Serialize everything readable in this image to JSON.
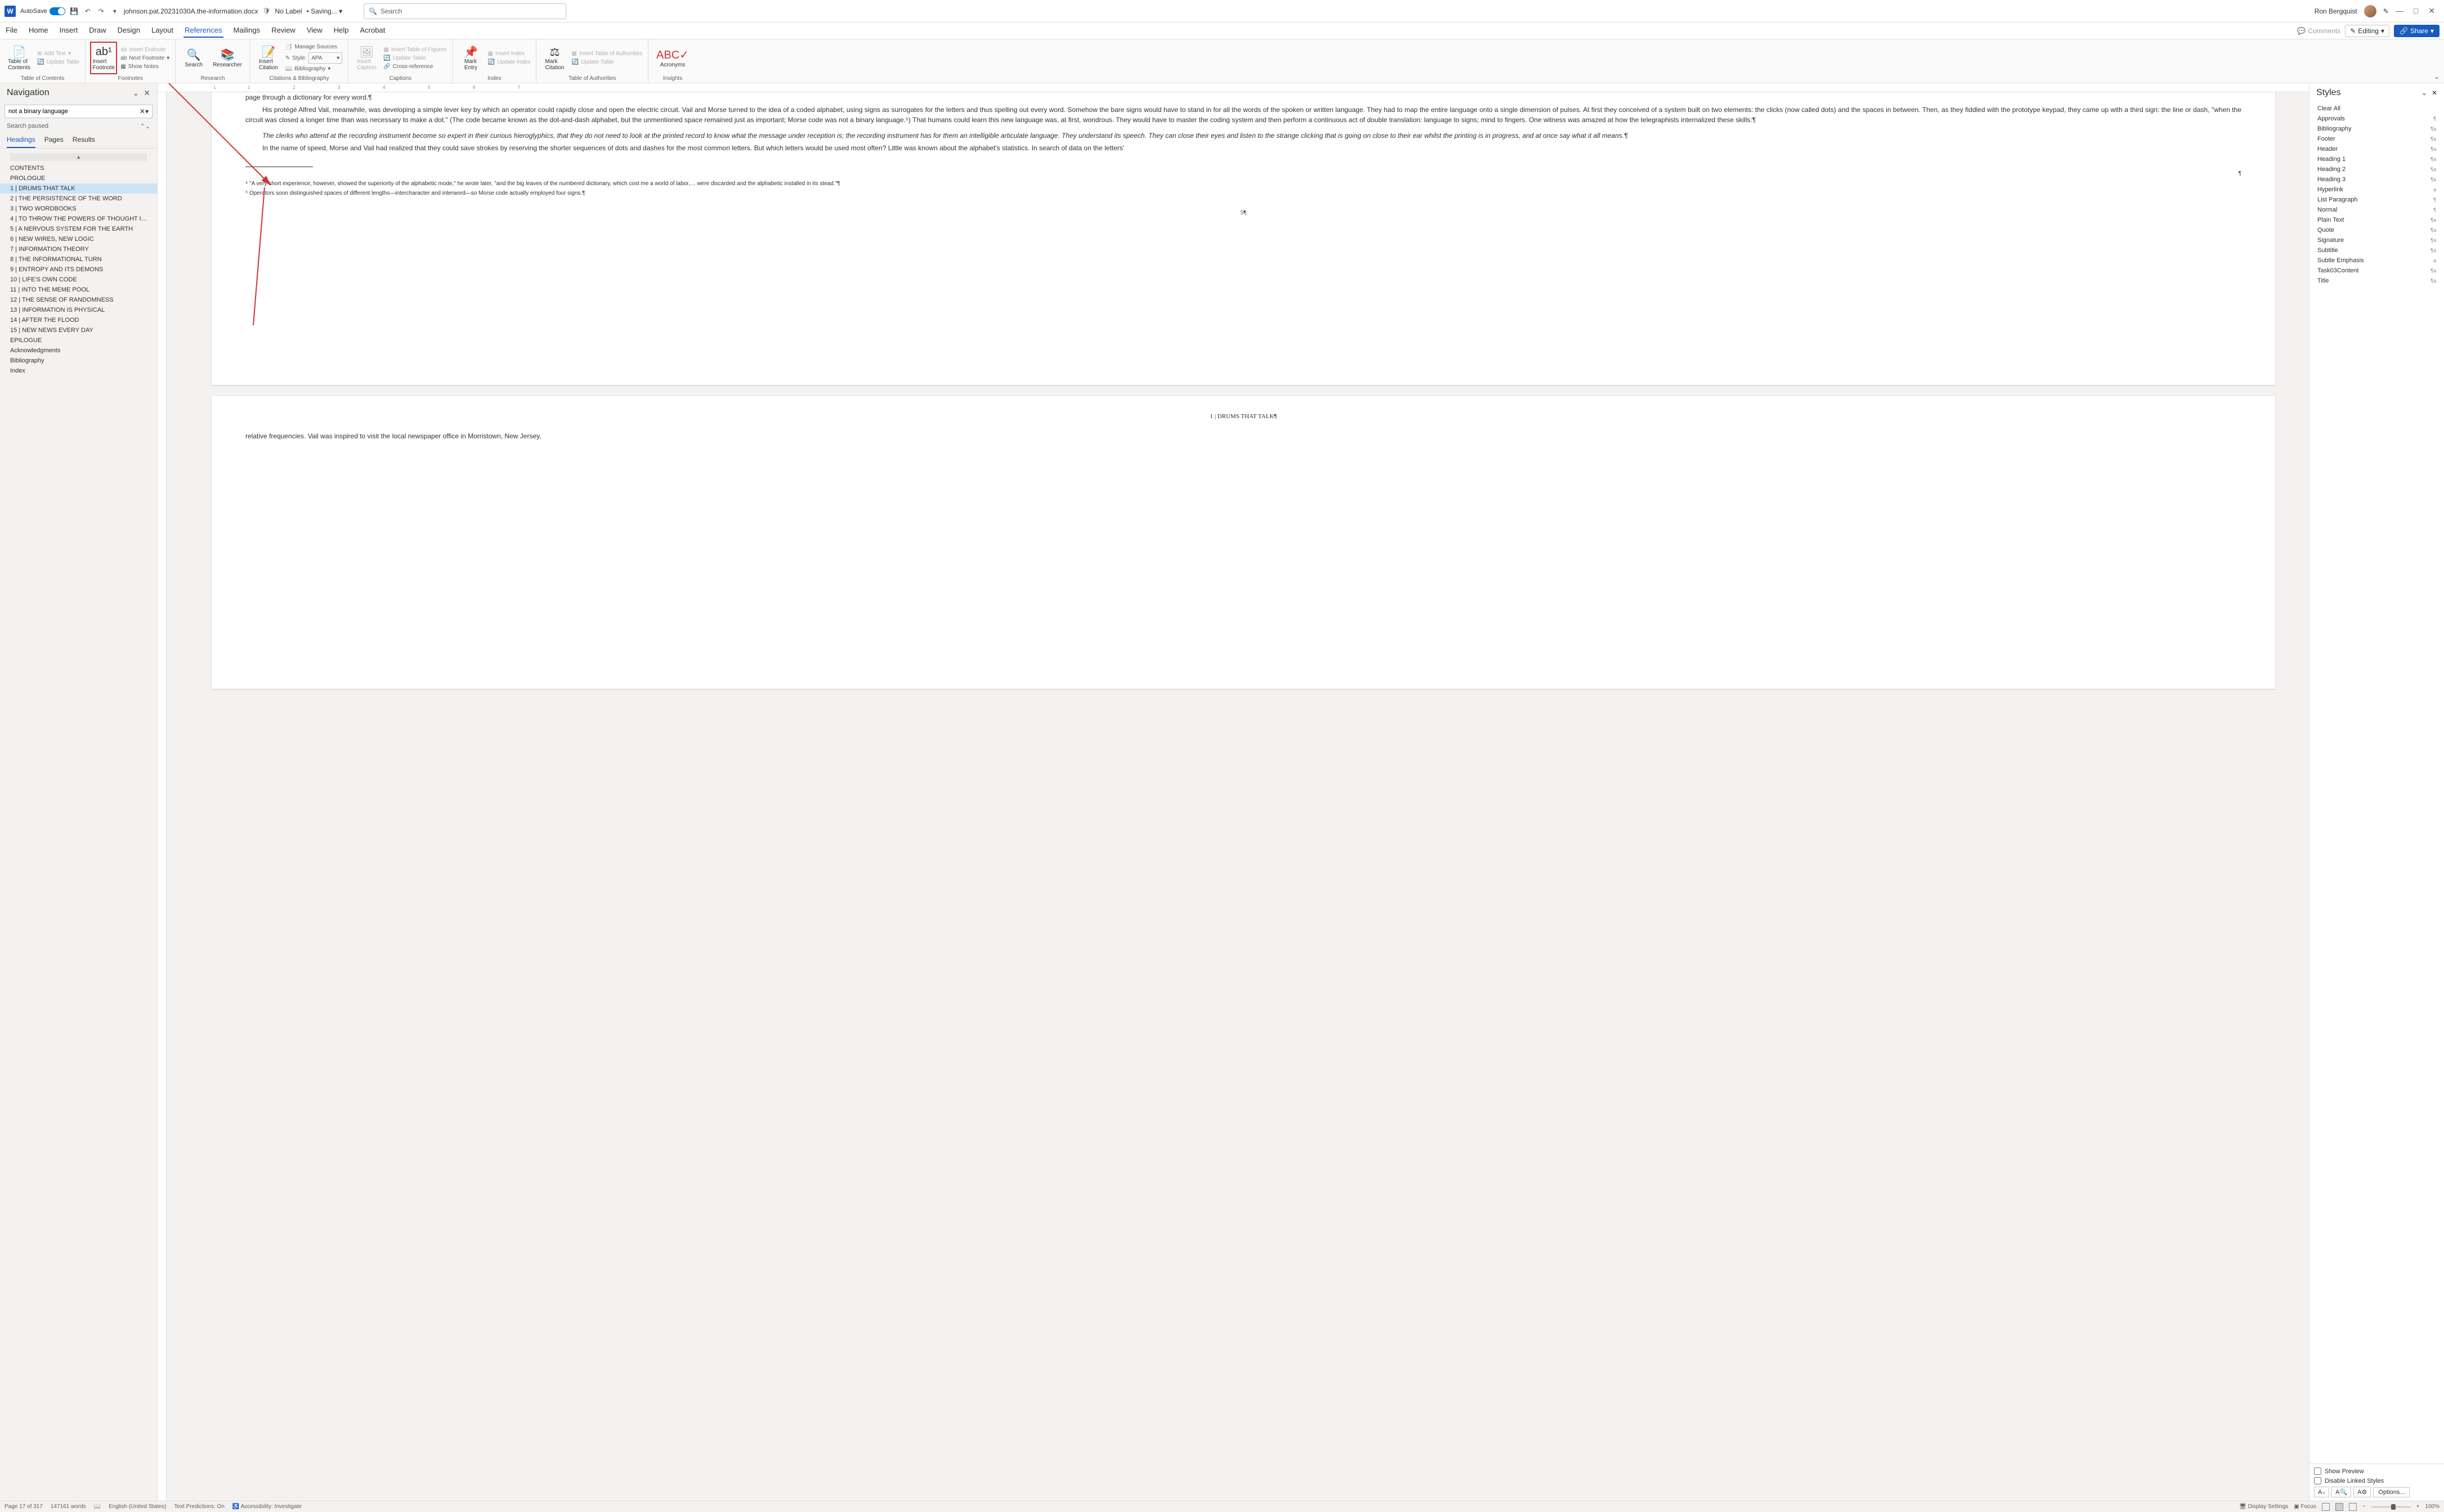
{
  "titlebar": {
    "autosave_label": "AutoSave",
    "autosave_on": "On",
    "filename": "johnson.pat.20231030A.the-information.docx",
    "sensitivity": "No Label",
    "saving": "Saving...",
    "search_placeholder": "Search",
    "username": "Ron Bergquist"
  },
  "tabs": {
    "items": [
      "File",
      "Home",
      "Insert",
      "Draw",
      "Design",
      "Layout",
      "References",
      "Mailings",
      "Review",
      "View",
      "Help",
      "Acrobat"
    ],
    "active": "References",
    "comments": "Comments",
    "editing": "Editing",
    "share": "Share"
  },
  "ribbon": {
    "toc": {
      "contents": "Table of\nContents",
      "add_text": "Add Text",
      "update": "Update Table",
      "group": "Table of Contents"
    },
    "footnotes": {
      "insert": "Insert\nFootnote",
      "next": "Next Footnote",
      "endnote": "Insert Endnote",
      "show": "Show Notes",
      "group": "Footnotes"
    },
    "research": {
      "search": "Search",
      "researcher": "Researcher",
      "group": "Research"
    },
    "citations": {
      "insert": "Insert\nCitation",
      "manage": "Manage Sources",
      "style_label": "Style:",
      "style_value": "APA",
      "biblio": "Bibliography",
      "group": "Citations & Bibliography"
    },
    "captions": {
      "insert": "Insert\nCaption",
      "table": "Insert Table of Figures",
      "update": "Update Table",
      "cross": "Cross-reference",
      "group": "Captions"
    },
    "index": {
      "mark": "Mark\nEntry",
      "insert": "Insert Index",
      "update": "Update Index",
      "group": "Index"
    },
    "authorities": {
      "mark": "Mark\nCitation",
      "insert": "Insert Table of Authorities",
      "update": "Update Table",
      "group": "Table of Authorities"
    },
    "insights": {
      "acronyms": "Acronyms",
      "group": "Insights"
    }
  },
  "nav": {
    "title": "Navigation",
    "search_value": "not a binary language",
    "status": "Search paused",
    "tabs": [
      "Headings",
      "Pages",
      "Results"
    ],
    "items": [
      {
        "t": "CONTENTS",
        "l": 0
      },
      {
        "t": "PROLOGUE",
        "l": 0
      },
      {
        "t": "1 | DRUMS THAT TALK",
        "l": 0,
        "sel": true
      },
      {
        "t": "2 | THE PERSISTENCE OF THE WORD",
        "l": 0
      },
      {
        "t": "3 | TWO WORDBOOKS",
        "l": 0
      },
      {
        "t": "4 | TO THROW THE POWERS OF THOUGHT INTO...",
        "l": 0
      },
      {
        "t": "5 | A NERVOUS SYSTEM FOR THE EARTH",
        "l": 0
      },
      {
        "t": "6 | NEW WIRES, NEW LOGIC",
        "l": 0
      },
      {
        "t": "7 | INFORMATION THEORY",
        "l": 0
      },
      {
        "t": "8 | THE INFORMATIONAL TURN",
        "l": 0
      },
      {
        "t": "9 | ENTROPY AND ITS DEMONS",
        "l": 0
      },
      {
        "t": "10 | LIFE'S OWN CODE",
        "l": 0
      },
      {
        "t": "11 | INTO THE MEME POOL",
        "l": 0
      },
      {
        "t": "12 | THE SENSE OF RANDOMNESS",
        "l": 0
      },
      {
        "t": "13 | INFORMATION IS PHYSICAL",
        "l": 0
      },
      {
        "t": "14 | AFTER THE FLOOD",
        "l": 0
      },
      {
        "t": "15 | NEW NEWS EVERY DAY",
        "l": 0
      },
      {
        "t": "EPILOGUE",
        "l": 0
      },
      {
        "t": "Acknowledgments",
        "l": 0
      },
      {
        "t": "Bibliography",
        "l": 0
      },
      {
        "t": "Index",
        "l": 0
      }
    ]
  },
  "document": {
    "para1": "page through a dictionary for every word.¶",
    "para2_indent": "His protégé Alfred Vail, meanwhile, was developing a simple lever key by which an operator could rapidly close and open the electric circuit. Vail and Morse turned to the idea of a coded alphabet, using signs as surrogates for the letters and thus spelling out every word. Somehow the bare signs would have to stand in for all the words of the spoken or written language. They had to map the entire language onto a single dimension of pulses. At first they conceived of a system built on two elements: the clicks (now called dots) and the spaces in between. Then, as they fiddled with the prototype keypad, they came up with a third sign: the line or dash, \"when the circuit was closed a longer time than was necessary to make a dot.\" (The code became known as the dot-and-dash alphabet, but the unmentioned space remained just as important; Morse code was not a binary language.⁵) That humans could learn this new language was, at first, wondrous. They would have to master the coding system and then perform a continuous act of double translation: language to signs; mind to fingers. One witness was amazed at how the telegraphists internalized these skills:¶",
    "quote": "The clerks who attend at the recording instrument become so expert in their curious hieroglyphics, that they do not need to look at the printed record to know what the message under reception is; the recording instrument has for them an intelligible articulate language. They understand its speech. They can close their eyes and listen to the strange clicking that is going on close to their ear whilst the printing is in progress, and at once say what it all means.¶",
    "para3": "In the name of speed, Morse and Vail had realized that they could save strokes by reserving the shorter sequences of dots and dashes for the most common letters. But which letters would be used most often? Little was known about the alphabet's statistics. In search of data on the letters'",
    "footnote1_marker": "⁴",
    "footnote1_text": "\"A very short experience, however, showed the superiority of the alphabetic mode,\" he wrote later, \"and the big leaves of the numbered dictionary, which cost me a world of labor,… were discarded and the alphabetic installed in its stead.\"¶",
    "footnote2_marker": "⁵",
    "footnote2_text": "Operators soon distinguished spaces of different lengths—intercharacter and interword—so Morse code actually employed four signs.¶",
    "page_num": "5¶",
    "page2_header": "1 | DRUMS THAT TALK¶",
    "page2_para": "relative frequencies. Vail was inspired to visit the local newspaper office in Morristown, New Jersey,"
  },
  "styles": {
    "title": "Styles",
    "clear": "Clear All",
    "items": [
      {
        "n": "Approvals",
        "m": "¶"
      },
      {
        "n": "Bibliography",
        "m": "¶a"
      },
      {
        "n": "Footer",
        "m": "¶a"
      },
      {
        "n": "Header",
        "m": "¶a"
      },
      {
        "n": "Heading 1",
        "m": "¶a"
      },
      {
        "n": "Heading 2",
        "m": "¶a"
      },
      {
        "n": "Heading 3",
        "m": "¶a"
      },
      {
        "n": "Hyperlink",
        "m": "a"
      },
      {
        "n": "List Paragraph",
        "m": "¶"
      },
      {
        "n": "Normal",
        "m": "¶"
      },
      {
        "n": "Plain Text",
        "m": "¶a"
      },
      {
        "n": "Quote",
        "m": "¶a"
      },
      {
        "n": "Signature",
        "m": "¶a"
      },
      {
        "n": "Subtitle",
        "m": "¶a"
      },
      {
        "n": "Subtle Emphasis",
        "m": "a"
      },
      {
        "n": "Task03Content",
        "m": "¶a"
      },
      {
        "n": "Title",
        "m": "¶a"
      }
    ],
    "show_preview": "Show Preview",
    "disable_linked": "Disable Linked Styles",
    "options": "Options..."
  },
  "statusbar": {
    "page": "Page 17 of 317",
    "words": "147161 words",
    "lang": "English (United States)",
    "predictions": "Text Predictions: On",
    "accessibility": "Accessibility: Investigate",
    "display": "Display Settings",
    "focus": "Focus",
    "zoom": "100%"
  }
}
